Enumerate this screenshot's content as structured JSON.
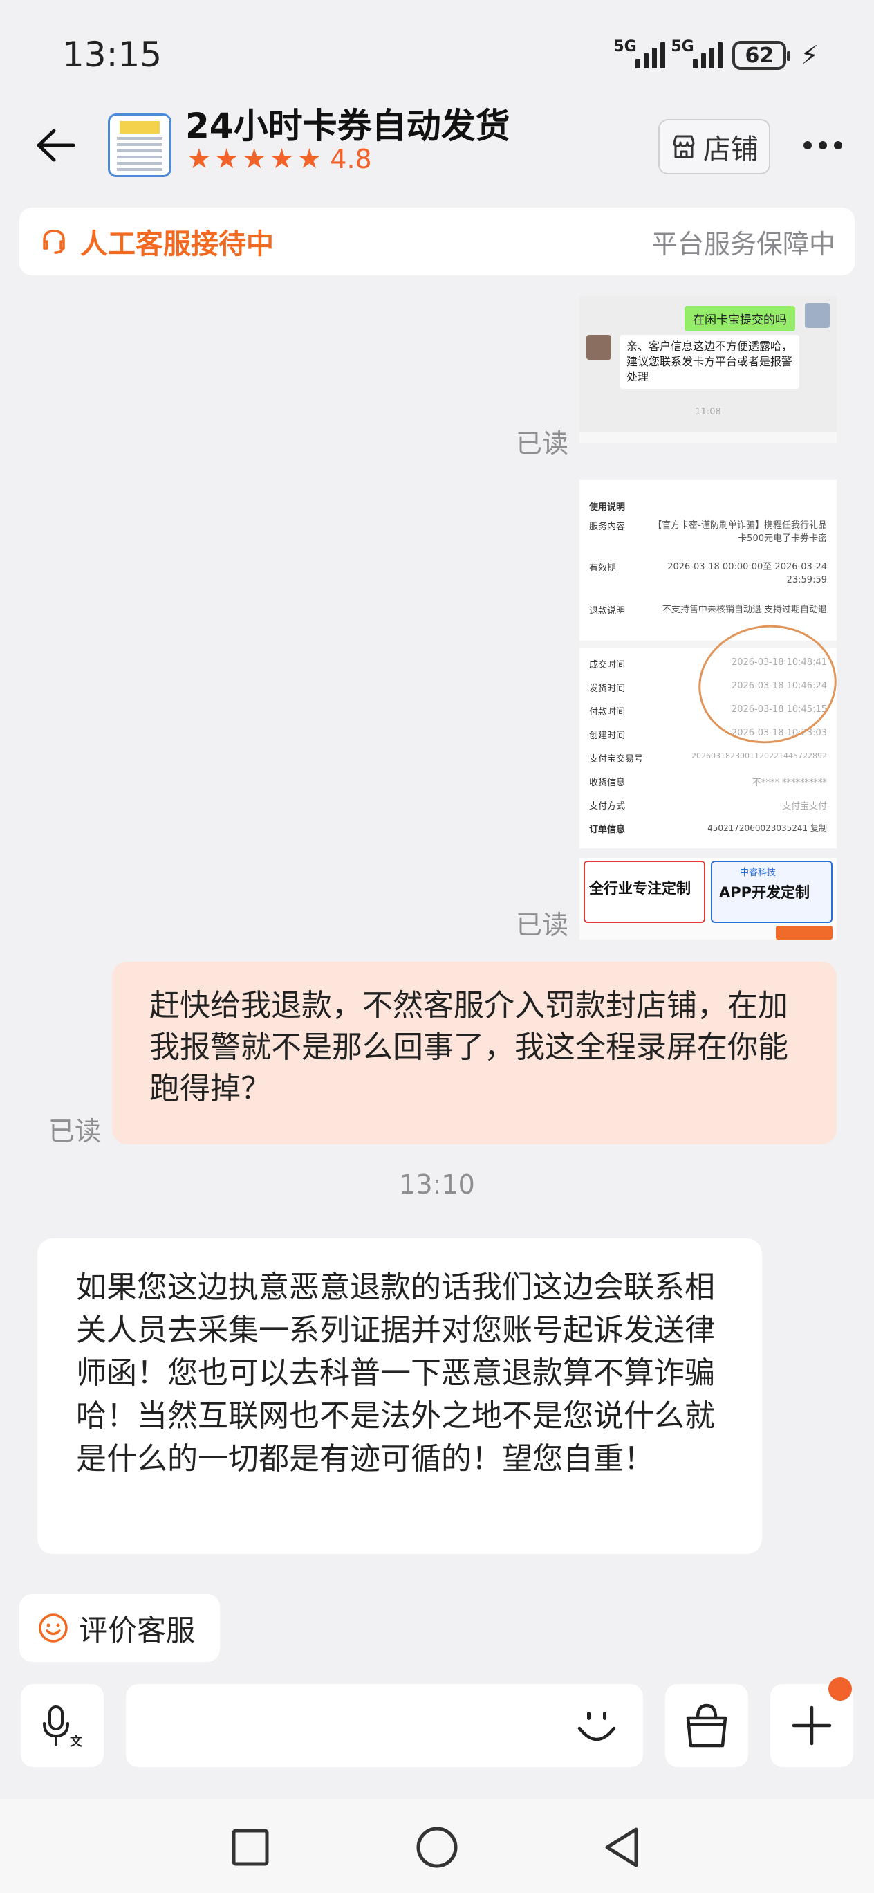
{
  "status_bar": {
    "time": "13:15",
    "signal1_label": "5G",
    "signal2_label": "5G",
    "battery": "62"
  },
  "header": {
    "shop_name": "24小时卡券自动发货",
    "rating": "4.8",
    "stars": 5,
    "store_label": "店铺",
    "icons": [
      "back-arrow-icon",
      "store-icon",
      "more-icon",
      "star-icon"
    ]
  },
  "service_banner": {
    "status": "人工客服接待中",
    "guarantee": "平台服务保障中",
    "icon": "headset-icon",
    "accent": "#f26a21"
  },
  "messages": {
    "read_label": "已读",
    "image1": {
      "sent_text": "在闲卡宝提交的吗",
      "reply_text": "亲、客户信息这边不方便透露哈，建议您联系发卡方平台或者是报警处理",
      "time": "11:08"
    },
    "image2": {
      "section": "使用说明",
      "rows": [
        {
          "k": "服务内容",
          "v": "【官方卡密-谨防刷单诈骗】携程任我行礼品卡500元电子卡券卡密"
        },
        {
          "k": "有效期",
          "v": "2026-03-18 00:00:00至 2026-03-24 23:59:59"
        },
        {
          "k": "退款说明",
          "v": "不支持售中未核销自动退 支持过期自动退"
        },
        {
          "k": "成交时间",
          "v": "2026-03-18 10:48:41"
        },
        {
          "k": "发货时间",
          "v": "2026-03-18 10:46:24"
        },
        {
          "k": "付款时间",
          "v": "2026-03-18 10:45:15"
        },
        {
          "k": "创建时间",
          "v": "2026-03-18 10:23:03"
        },
        {
          "k": "支付宝交易号",
          "v": "2026031823001120221445722892"
        },
        {
          "k": "收货信息",
          "v": "不****  **********"
        },
        {
          "k": "支付方式",
          "v": "支付宝支付"
        },
        {
          "k": "订单信息",
          "v": "4502172060023035241 复制"
        }
      ],
      "ad1": "全行业专注定制",
      "ad2": "APP开发定制",
      "ad2_brand": "中睿科技"
    },
    "sent_text": "赶快给我退款，不然客服介入罚款封店铺，在加我报警就不是那么回事了，我这全程录屏在你能跑得掉？",
    "timestamp": "13:10",
    "received_text": "如果您这边执意恶意退款的话我们这边会联系相关人员去采集一系列证据并对您账号起诉发送律师函！您也可以去科普一下恶意退款算不算诈骗哈！当然互联网也不是法外之地不是您说什么就是什么的一切都是有迹可循的！望您自重！",
    "bubble_out_color": "#fde5db"
  },
  "bottom": {
    "evaluate_label": "评价客服",
    "input_placeholder": "",
    "icons": [
      "smile-icon",
      "voice-input-icon",
      "emoji-icon",
      "shopping-bag-icon",
      "plus-icon",
      "square-nav-icon",
      "circle-nav-icon",
      "triangle-nav-icon"
    ]
  }
}
